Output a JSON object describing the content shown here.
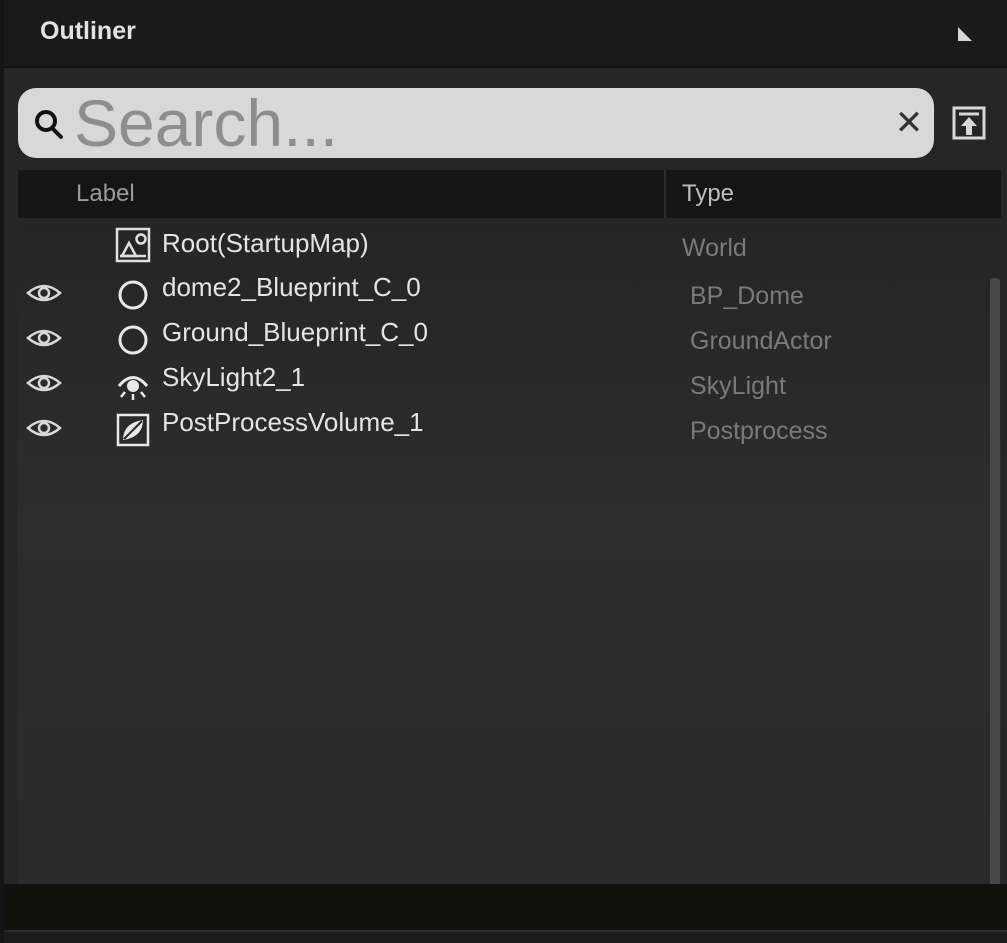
{
  "panel": {
    "title": "Outliner"
  },
  "search": {
    "placeholder": "Search...",
    "value": ""
  },
  "columns": {
    "label": "Label",
    "type": "Type"
  },
  "rows": [
    {
      "label": "Root(StartupMap)",
      "type": "World",
      "icon": "world-icon",
      "visible_toggle": false
    },
    {
      "label": "dome2_Blueprint_C_0",
      "type": "BP_Dome",
      "icon": "actor-circle-icon",
      "visible_toggle": true
    },
    {
      "label": "Ground_Blueprint_C_0",
      "type": "GroundActor",
      "icon": "actor-circle-icon",
      "visible_toggle": true
    },
    {
      "label": "SkyLight2_1",
      "type": "SkyLight",
      "icon": "skylight-icon",
      "visible_toggle": true
    },
    {
      "label": "PostProcessVolume_1",
      "type": "Postprocess",
      "icon": "postprocess-icon",
      "visible_toggle": true
    }
  ],
  "colors": {
    "panel_bg": "#262626",
    "titlebar_bg": "#1a1a1a",
    "search_bg": "#d8d8d8",
    "label_text": "#e4e4e4",
    "type_text": "#7a7a7a"
  }
}
